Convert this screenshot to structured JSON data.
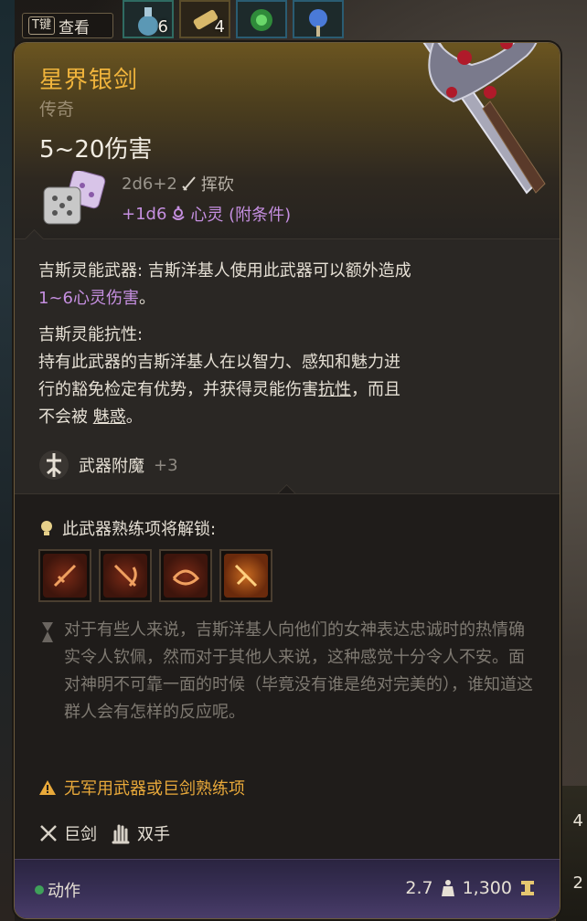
{
  "hotbar": {
    "key_label": "T键",
    "view_label": "查看",
    "slot1_count": "6",
    "slot2_count": "4"
  },
  "item": {
    "name": "星界银剑",
    "rarity": "传奇",
    "damage_total": "5~20伤害",
    "damage_line1_dice": "2d6+2",
    "damage_line1_type": "挥砍",
    "damage_line2_dice": "+1d6",
    "damage_line2_type": "心灵 (附条件)"
  },
  "ability1": {
    "name": "吉斯灵能武器:",
    "text": " 吉斯洋基人使用此武器可以额外造成",
    "text2": "1~6心灵伤害",
    "text2_suffix": "。"
  },
  "ability2": {
    "name": "吉斯灵能抗性:",
    "line1": "持有此武器的吉斯洋基人在以智力、感知和魅力进",
    "line2a": "行的豁免检定有优势，并获得灵能伤害",
    "line2b": "抗性",
    "line2c": "，而且",
    "line3a": "不会被 ",
    "line3b": "魅惑",
    "line3c": "。"
  },
  "enchant": {
    "label": "武器附魔",
    "value": "+3"
  },
  "proficiency": {
    "title": "此武器熟练项将解锁:",
    "icons": [
      "slash-ability-icon",
      "cleave-ability-icon",
      "lacerate-ability-icon",
      "pommel-strike-ability-icon"
    ]
  },
  "flavor": {
    "text": "对于有些人来说，吉斯洋基人向他们的女神表达忠诚时的热情确实令人钦佩，然而对于其他人来说，这种感觉十分令人不安。面对神明不可靠一面的时候（毕竟没有谁是绝对完美的），谁知道这群人会有怎样的反应呢。"
  },
  "warning": {
    "text": "无军用武器或巨剑熟练项"
  },
  "properties": {
    "type": "巨剑",
    "hands": "双手"
  },
  "footer": {
    "action": "动作",
    "weight": "2.7",
    "price": "1,300"
  },
  "right_edge_counts": [
    "4",
    "2"
  ],
  "colors": {
    "title": "#f0b43c",
    "psychic": "#c58fe0",
    "warning": "#e9a93a",
    "action_dot": "#3fa15a"
  }
}
